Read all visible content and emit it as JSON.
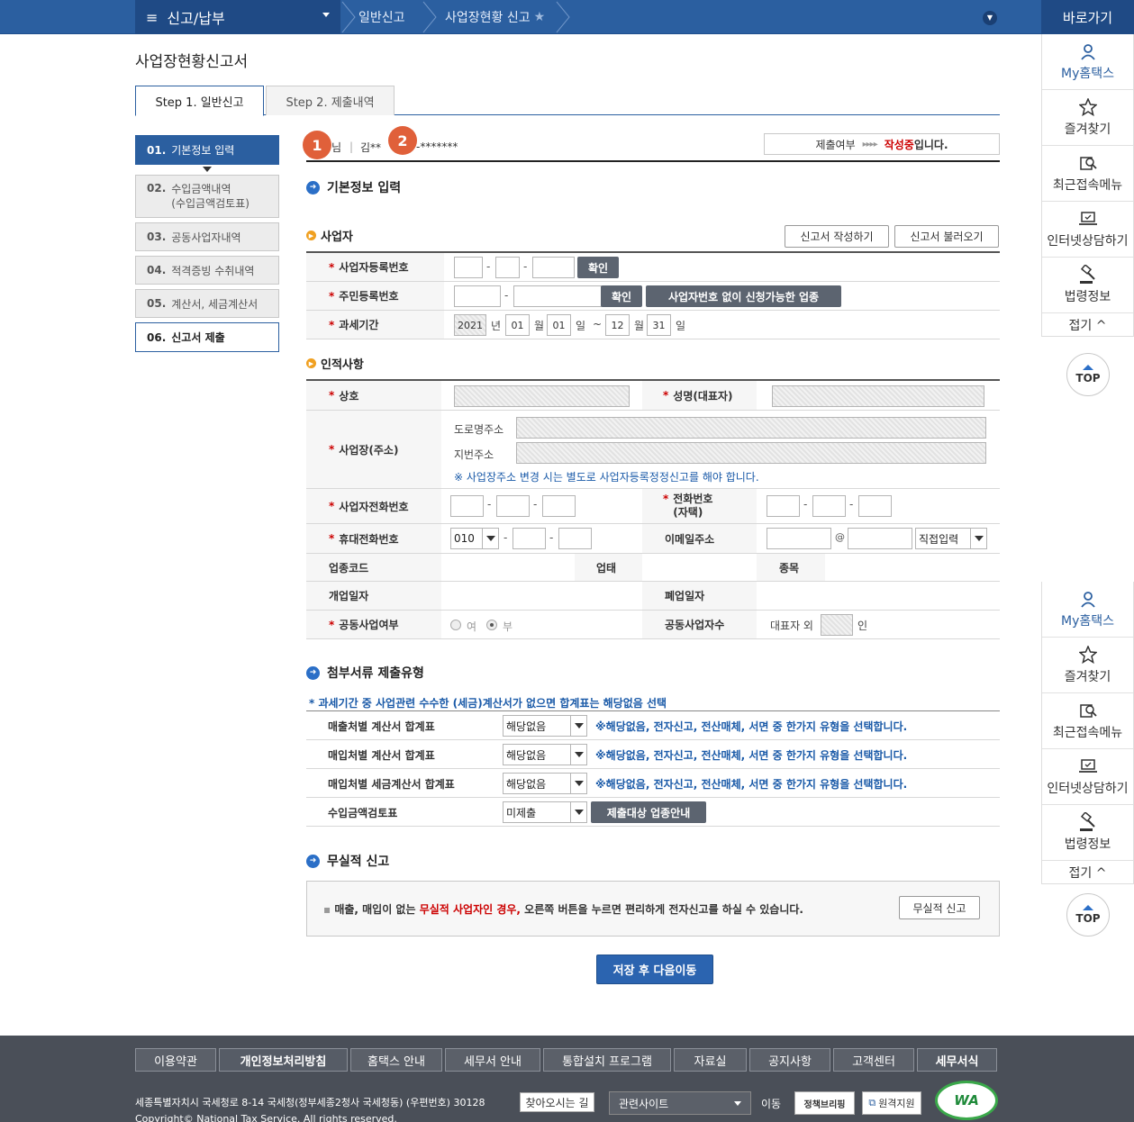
{
  "topbar": {
    "menu_label": "신고/납부",
    "crumb1": "일반신고",
    "crumb2": "사업장현황 신고"
  },
  "quick": {
    "header": "바로가기",
    "items": [
      "My홈택스",
      "즐겨찾기",
      "최근접속메뉴",
      "인터넷상담하기",
      "법령정보"
    ],
    "fold": "접기 ^",
    "top": "TOP"
  },
  "page": {
    "title": "사업장현황신고서",
    "tab1": "Step 1. 일반신고",
    "tab2": "Step 2. 제출내역"
  },
  "leftnav": {
    "items": [
      {
        "num": "01.",
        "label": "기본정보 입력"
      },
      {
        "num": "02.",
        "label": "수입금액내역",
        "label2": "(수입금액검토표)"
      },
      {
        "num": "03.",
        "label": "공동사업자내역"
      },
      {
        "num": "04.",
        "label": "적격증빙 수취내역"
      },
      {
        "num": "05.",
        "label": "계산서, 세금계산서"
      },
      {
        "num": "06.",
        "label": "신고서 제출"
      }
    ]
  },
  "userline": {
    "badge1": "1",
    "badge2": "2",
    "name_suffix": "님",
    "name": "김**",
    "masked": "-*******",
    "status_label": "제출여부",
    "status_arrows": "▸▸▸▸",
    "status_value": "작성중",
    "status_tail": "입니다."
  },
  "basic": {
    "heading": "기본정보 입력",
    "biz_heading": "사업자",
    "write_btn": "신고서 작성하기",
    "load_btn": "신고서 불러오기",
    "bizno_label": "사업자등록번호",
    "confirm": "확인",
    "rrn_label": "주민등록번호",
    "no_biz_btn": "사업자번호 없이 신청가능한 업종",
    "period_label": "과세기간",
    "year": "2021",
    "year_unit": "년",
    "m1": "01",
    "month_unit": "월",
    "d1": "01",
    "day_unit": "일",
    "tilde": "~",
    "m2": "12",
    "d2": "31"
  },
  "personal": {
    "heading": "인적사항",
    "trade_label": "상호",
    "rep_label": "성명(대표자)",
    "addr_label": "사업장(주소)",
    "road_label": "도로명주소",
    "lot_label": "지번주소",
    "addr_note": "※ 사업장주소 변경 시는 별도로 사업자등록정정신고를 해야 합니다.",
    "biz_phone_label": "사업자전화번호",
    "home_phone_label": "전화번호",
    "home_phone_label2": "(자택)",
    "mobile_label": "휴대전화번호",
    "mobile_prefix": "010",
    "email_label": "이메일주소",
    "at": "@",
    "email_select": "직접입력",
    "ind_code_label": "업종코드",
    "biz_type_label": "업태",
    "item_label": "종목",
    "open_label": "개업일자",
    "close_label": "폐업일자",
    "joint_label": "공동사업여부",
    "yes": "여",
    "no": "부",
    "joint_count_label": "공동사업자수",
    "rep_extra": "대표자 외",
    "person_unit": "인"
  },
  "attach": {
    "heading": "첨부서류 제출유형",
    "note": "* 과세기간 중 사업관련 수수한 (세금)계산서가 없으면 합계표는 해당없음 선택",
    "rows": [
      {
        "label": "매출처별 계산서 합계표",
        "value": "해당없음",
        "note": "※해당없음, 전자신고, 전산매체, 서면 중 한가지 유형을 선택합니다."
      },
      {
        "label": "매입처별 계산서 합계표",
        "value": "해당없음",
        "note": "※해당없음, 전자신고, 전산매체, 서면 중 한가지 유형을 선택합니다."
      },
      {
        "label": "매입처별 세금계산서 합계표",
        "value": "해당없음",
        "note": "※해당없음, 전자신고, 전산매체, 서면 중 한가지 유형을 선택합니다."
      },
      {
        "label": "수입금액검토표",
        "value": "미제출",
        "btn": "제출대상 업종안내"
      }
    ]
  },
  "nil": {
    "heading": "무실적 신고",
    "pre": "매출, 매입이 없는",
    "red": "무실적 사업자인 경우,",
    "post": "오른쪽 버튼을 누르면 편리하게 전자신고를 하실 수 있습니다.",
    "btn": "무실적 신고"
  },
  "save_btn": "저장 후 다음이동",
  "footer": {
    "links": [
      "이용약관",
      "개인정보처리방침",
      "홈택스 안내",
      "세무서 안내",
      "통합설치 프로그램",
      "자료실",
      "공지사항",
      "고객센터",
      "세무서식"
    ],
    "address": "세종특별자치시 국세청로 8-14 국세청(정부세종2청사 국세청동) (우편번호) 30128",
    "find": "찾아오시는 길",
    "related": "관련사이트",
    "move": "이동",
    "policy": "정책브리핑",
    "remote": "원격지원",
    "copyright": "Copyright© National Tax Service. All rights reserved.",
    "wa": "WA"
  },
  "colors": {
    "primary": "#2b5fa0",
    "accent_red": "#cc0000",
    "badge": "#e0603a",
    "footer_bg": "#4a4f58"
  }
}
